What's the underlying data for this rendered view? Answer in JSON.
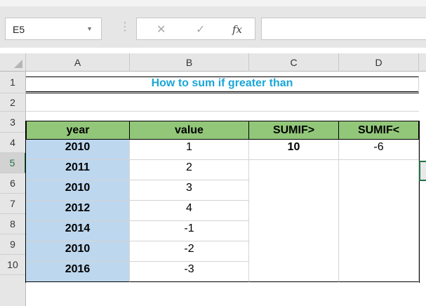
{
  "formula_bar": {
    "name_box": "E5",
    "cancel_icon": "✕",
    "enter_icon": "✓",
    "fx_label": "fx",
    "formula": ""
  },
  "columns": [
    "A",
    "B",
    "C",
    "D"
  ],
  "rows": [
    "1",
    "2",
    "3",
    "4",
    "5",
    "6",
    "7",
    "8",
    "9",
    "10"
  ],
  "title": "How to sum if greater than",
  "table": {
    "headers": [
      "year",
      "value",
      "SUMIF>",
      "SUMIF<"
    ],
    "years": [
      "2010",
      "2011",
      "2010",
      "2012",
      "2014",
      "2010",
      "2016"
    ],
    "values": [
      "1",
      "2",
      "3",
      "4",
      "-1",
      "-2",
      "-3"
    ],
    "sumif_greater": "10",
    "sumif_less": "-6"
  },
  "colors": {
    "header_fill": "#92c77a",
    "year_fill": "#bdd7ee",
    "title_text": "#1aa6d8",
    "selection": "#217346"
  }
}
